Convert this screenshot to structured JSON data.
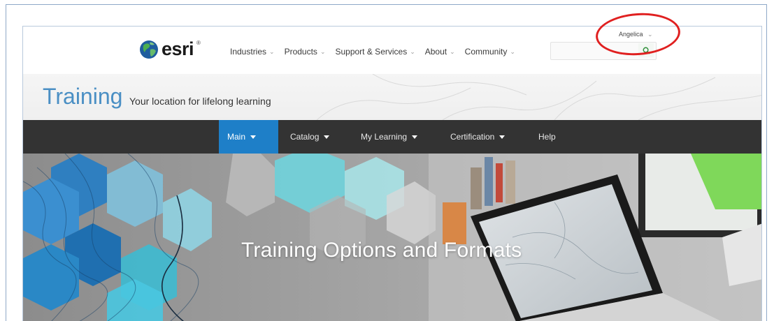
{
  "header": {
    "logo_text": "esri",
    "nav": [
      {
        "label": "Industries"
      },
      {
        "label": "Products"
      },
      {
        "label": "Support & Services"
      },
      {
        "label": "About"
      },
      {
        "label": "Community"
      }
    ],
    "user_name": "Angelica",
    "search_placeholder": ""
  },
  "training": {
    "title": "Training",
    "tagline": "Your location for lifelong learning"
  },
  "subnav": {
    "items": [
      {
        "label": "Main",
        "active": true,
        "dropdown": true
      },
      {
        "label": "Catalog",
        "active": false,
        "dropdown": true
      },
      {
        "label": "My Learning",
        "active": false,
        "dropdown": true
      },
      {
        "label": "Certification",
        "active": false,
        "dropdown": true
      },
      {
        "label": "Help",
        "active": false,
        "dropdown": false
      }
    ]
  },
  "hero": {
    "title": "Training Options and Formats"
  },
  "icons": {
    "logo": "esri-globe-icon",
    "caret": "chevron-down-icon",
    "search": "search-icon",
    "dropdown": "caret-down-icon"
  },
  "colors": {
    "brand_blue": "#4a8fc4",
    "active_tab": "#1e7fc8",
    "dark_nav": "#333333",
    "annotation_ring": "#e02020",
    "search_icon": "#2f8f3a"
  }
}
